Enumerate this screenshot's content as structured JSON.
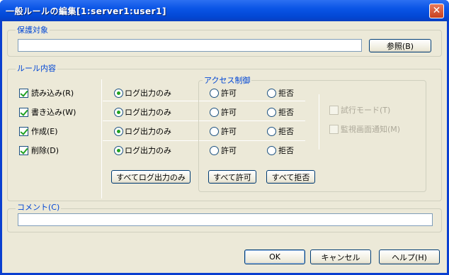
{
  "window": {
    "title": "一般ルールの編集[1:server1:user1]",
    "close_glyph": "✕"
  },
  "protect": {
    "label": "保護対象",
    "value": "",
    "browse_button": "参照(B)"
  },
  "rules": {
    "label": "ルール内容",
    "access_label": "アクセス制御",
    "rows": [
      {
        "name": "読み込み(R)",
        "checked": true,
        "option": "ログ出力のみ",
        "allow": "許可",
        "deny": "拒否"
      },
      {
        "name": "書き込み(W)",
        "checked": true,
        "option": "ログ出力のみ",
        "allow": "許可",
        "deny": "拒否"
      },
      {
        "name": "作成(E)",
        "checked": true,
        "option": "ログ出力のみ",
        "allow": "許可",
        "deny": "拒否"
      },
      {
        "name": "削除(D)",
        "checked": true,
        "option": "ログ出力のみ",
        "allow": "許可",
        "deny": "拒否"
      }
    ],
    "all_log_button": "すべてログ出力のみ",
    "all_allow_button": "すべて許可",
    "all_deny_button": "すべて拒否",
    "trial_mode": "試行モード(T)",
    "monitor_notify": "監視画面通知(M)"
  },
  "comment": {
    "label": "コメント(C)",
    "value": ""
  },
  "buttons": {
    "ok": "OK",
    "cancel": "キャンセル",
    "help": "ヘルプ(H)"
  }
}
